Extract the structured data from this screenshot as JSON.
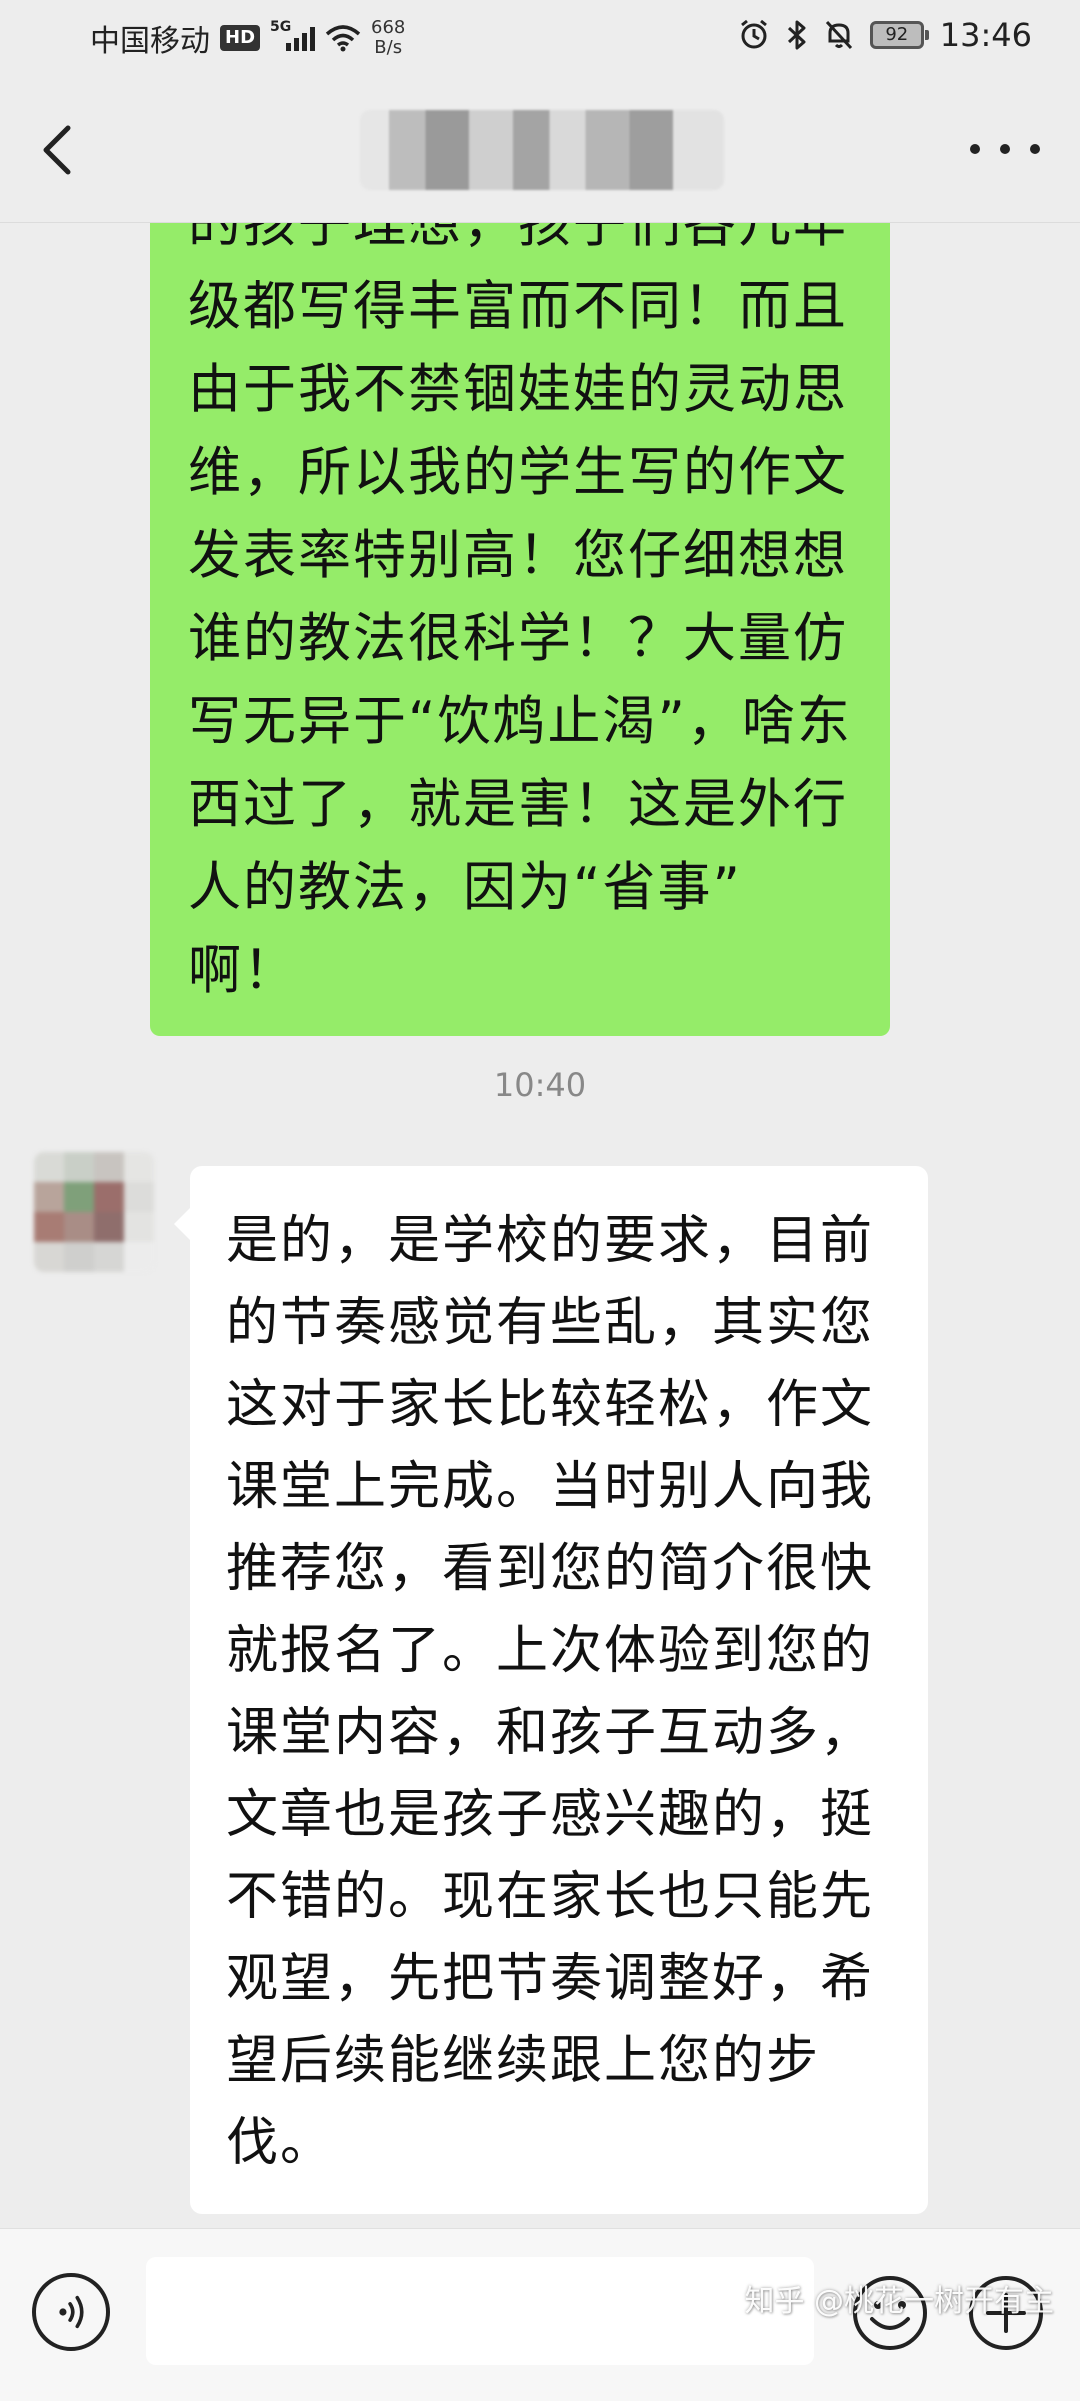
{
  "status_bar": {
    "carrier": "中国移动",
    "hd": "HD",
    "network": "5G",
    "speed_value": "668",
    "speed_unit": "B/s",
    "battery": "92",
    "time": "13:46",
    "icons": [
      "hd-icon",
      "signal-icon",
      "wifi-icon",
      "alarm-icon",
      "bluetooth-icon",
      "mute-icon",
      "battery-icon"
    ]
  },
  "header": {
    "back_icon": "back-chevron-icon",
    "title": "",
    "more_icon": "more-dots-icon"
  },
  "messages": [
    {
      "side": "right",
      "bubble_color": "#95ec69",
      "lines": [
        "的孩子理想，孩子们各几年",
        "级都写得丰富而不同！而且",
        "由于我不禁锢娃娃的灵动思",
        "维，所以我的学生写的作文",
        "发表率特别高！您仔细想想",
        "谁的教法很科学！？大量仿",
        "写无异于“饮鸩止渴”，啥东",
        "西过了，就是害！这是外行",
        "人的教法，因为“省事”",
        "啊！"
      ]
    },
    {
      "type": "timestamp",
      "text": "10:40"
    },
    {
      "side": "left",
      "bubble_color": "#ffffff",
      "lines": [
        "是的，是学校的要求，目前",
        "的节奏感觉有些乱，其实您",
        "这对于家长比较轻松，作文",
        "课堂上完成。当时别人向我",
        "推荐您，看到您的简介很快",
        "就报名了。上次体验到您的",
        "课堂内容，和孩子互动多，",
        "文章也是孩子感兴趣的，挺",
        "不错的。现在家长也只能先",
        "观望，先把节奏调整好，希",
        "望后续能继续跟上您的步",
        "伐。"
      ]
    }
  ],
  "input_bar": {
    "voice_icon": "voice-icon",
    "input_value": "",
    "emoji_icon": "emoji-icon",
    "plus_icon": "plus-icon"
  },
  "watermark": "知乎 @桃花一树开有主",
  "colors": {
    "background": "#ededed",
    "sent_bubble": "#95ec69",
    "received_bubble": "#ffffff",
    "timestamp": "#888888"
  }
}
